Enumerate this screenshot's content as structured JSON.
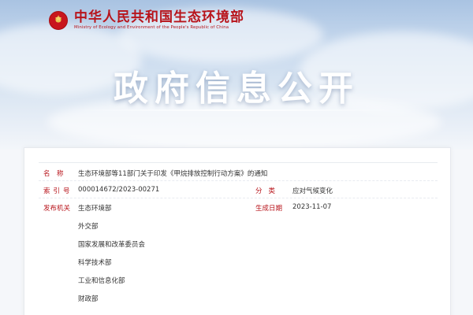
{
  "header": {
    "org_cn": "中华人民共和国生态环境部",
    "org_en": "Ministry of Ecology and Environment of the People's Republic of China",
    "emblem_icon": "national-emblem-icon"
  },
  "hero": {
    "title": "政府信息公开"
  },
  "document": {
    "name_label": "名　称",
    "name_value": "生态环境部等11部门关于印发《甲烷排放控制行动方案》的通知",
    "index_label": "索引号",
    "index_value": "000014672/2023-00271",
    "category_label": "分类",
    "category_value": "应对气候变化",
    "publisher_label": "发布机关",
    "date_label": "生成日期",
    "date_value": "2023-11-07",
    "publishers": [
      "生态环境部",
      "外交部",
      "国家发展和改革委员会",
      "科学技术部",
      "工业和信息化部",
      "财政部"
    ]
  },
  "colors": {
    "brand_red": "#b8141b",
    "hero_sky": "#c7d9ee",
    "panel_bg": "#ffffff"
  }
}
